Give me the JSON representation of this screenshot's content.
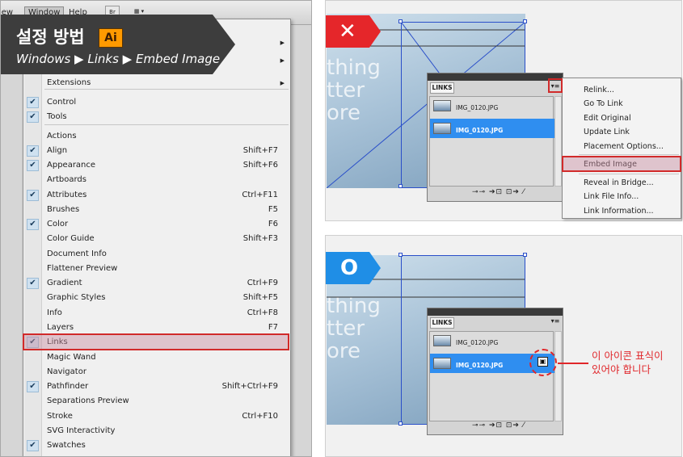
{
  "banner": {
    "title": "설정 방법",
    "badge": "Ai",
    "path": "Windows ▶ Links ▶ Embed Image",
    "color": "#3d3d3d"
  },
  "menubar": {
    "items": [
      "iew",
      "Window",
      "Help"
    ],
    "tool_labels": [
      "Br",
      "▦ ▾"
    ]
  },
  "window_menu": {
    "items": [
      {
        "label": "",
        "shortcut": "",
        "checked": false,
        "submenu": true
      },
      {
        "label": "",
        "shortcut": "",
        "checked": false,
        "submenu": true
      },
      {
        "label": "Extensions",
        "shortcut": "",
        "checked": false,
        "submenu": true
      },
      {
        "label": "Control",
        "shortcut": "",
        "checked": true
      },
      {
        "label": "Tools",
        "shortcut": "",
        "checked": true
      },
      {
        "label": "Actions",
        "shortcut": "",
        "checked": false
      },
      {
        "label": "Align",
        "shortcut": "Shift+F7",
        "checked": true
      },
      {
        "label": "Appearance",
        "shortcut": "Shift+F6",
        "checked": true
      },
      {
        "label": "Artboards",
        "shortcut": "",
        "checked": false
      },
      {
        "label": "Attributes",
        "shortcut": "Ctrl+F11",
        "checked": true
      },
      {
        "label": "Brushes",
        "shortcut": "F5",
        "checked": false
      },
      {
        "label": "Color",
        "shortcut": "F6",
        "checked": true
      },
      {
        "label": "Color Guide",
        "shortcut": "Shift+F3",
        "checked": false
      },
      {
        "label": "Document Info",
        "shortcut": "",
        "checked": false
      },
      {
        "label": "Flattener Preview",
        "shortcut": "",
        "checked": false
      },
      {
        "label": "Gradient",
        "shortcut": "Ctrl+F9",
        "checked": true
      },
      {
        "label": "Graphic Styles",
        "shortcut": "Shift+F5",
        "checked": false
      },
      {
        "label": "Info",
        "shortcut": "Ctrl+F8",
        "checked": false
      },
      {
        "label": "Layers",
        "shortcut": "F7",
        "checked": false
      },
      {
        "label": "Links",
        "shortcut": "",
        "checked": true,
        "highlighted": true
      },
      {
        "label": "Magic Wand",
        "shortcut": "",
        "checked": false
      },
      {
        "label": "Navigator",
        "shortcut": "",
        "checked": false
      },
      {
        "label": "Pathfinder",
        "shortcut": "Shift+Ctrl+F9",
        "checked": true
      },
      {
        "label": "Separations Preview",
        "shortcut": "",
        "checked": false
      },
      {
        "label": "Stroke",
        "shortcut": "Ctrl+F10",
        "checked": false
      },
      {
        "label": "SVG Interactivity",
        "shortcut": "",
        "checked": false
      },
      {
        "label": "Swatches",
        "shortcut": "",
        "checked": true
      }
    ]
  },
  "wrong_example": {
    "badge_symbol": "✕",
    "badge_color": "#e5262a",
    "art_text": [
      "thing",
      "tter",
      "ore"
    ],
    "links_panel": {
      "tab": "LINKS",
      "rows": [
        {
          "name": "IMG_0120.JPG",
          "selected": false
        },
        {
          "name": "IMG_0120.JPG",
          "selected": true
        }
      ],
      "footer": "⊸⊸ ➔⊡ ⊡➔ ⁄"
    },
    "context_menu": {
      "items": [
        "Relink...",
        "Go To Link",
        "Edit Original",
        "Update Link",
        "Placement Options...",
        "Embed Image",
        "Reveal in Bridge...",
        "Link File Info...",
        "Link Information..."
      ],
      "highlighted": "Embed Image"
    }
  },
  "right_example": {
    "badge_symbol": "O",
    "badge_color": "#1f8ee6",
    "art_text": [
      "thing",
      "tter",
      "ore"
    ],
    "links_panel": {
      "tab": "LINKS",
      "rows": [
        {
          "name": "IMG_0120.JPG",
          "selected": false
        },
        {
          "name": "IMG_0120.JPG",
          "selected": true
        }
      ],
      "footer": "⊸⊸ ➔⊡ ⊡➔ ⁄"
    },
    "callout": "이 아이콘 표식이\n있어야 합니다",
    "callout_color": "#e0262a"
  }
}
